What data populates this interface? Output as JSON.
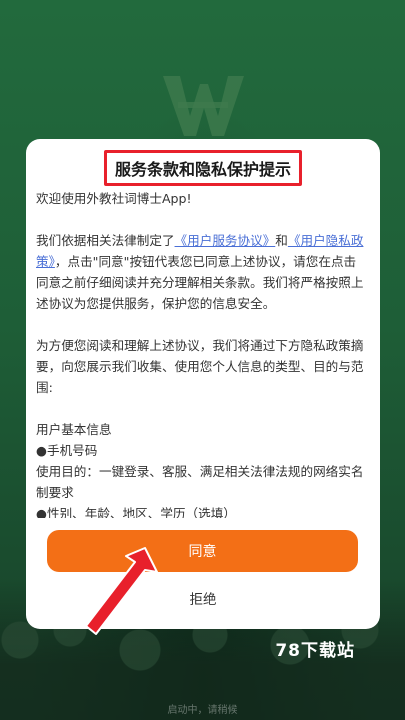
{
  "dialog": {
    "title": "服务条款和隐私保护提示",
    "welcome": "欢迎使用外教社词博士App!",
    "para1_a": "我们依据相关法律制定了",
    "link_service": "《用户服务协议》",
    "para1_and": "和",
    "link_privacy": "《用户隐私政策》",
    "para1_b": "，点击\"同意\"按钮代表您已同意上述协议，请您在点击同意之前仔细阅读并充分理解相关条款。我们将严格按照上述协议为您提供服务，保护您的信息安全。",
    "para2": "为方便您阅读和理解上述协议，我们将通过下方隐私政策摘要，向您展示我们收集、使用您个人信息的类型、目的与范围:",
    "section_heading": "用户基本信息",
    "item1": "●手机号码",
    "item1_purpose": "使用目的：一键登录、客服、满足相关法律法规的网络实名制要求",
    "item2": "●性别、年龄、地区、学历（选填）",
    "agree_label": "同意",
    "reject_label": "拒绝"
  },
  "watermark": "78下载站",
  "bottom_text": "启动中，请稍候",
  "colors": {
    "background": "#1f5a36",
    "accent": "#f36f16",
    "link": "#4a6fd6",
    "highlight": "#e8202b"
  }
}
